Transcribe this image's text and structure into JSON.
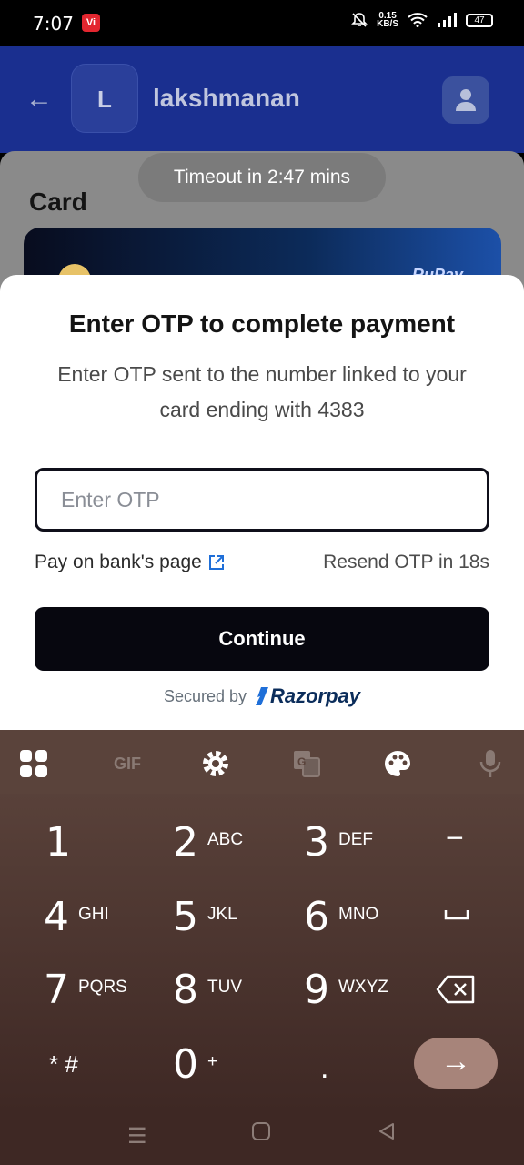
{
  "status_bar": {
    "time": "7:07",
    "carrier_badge": "Vi",
    "net_speed_value": "0.15",
    "net_speed_unit": "KB/S",
    "battery": "47"
  },
  "app": {
    "avatar_letter": "L",
    "merchant_name": "lakshmanan",
    "section_title": "Card",
    "card_brand": "RuPay",
    "timeout_text": "Timeout in 2:47 mins"
  },
  "otp_sheet": {
    "title": "Enter OTP to complete payment",
    "subtitle": "Enter OTP sent to the number linked to your card ending with 4383",
    "input_placeholder": "Enter OTP",
    "input_value": "",
    "bank_page_link": "Pay on bank's page",
    "resend_text": "Resend OTP in 18s",
    "continue_label": "Continue",
    "secured_by": "Secured by",
    "provider": "Razorpay"
  },
  "keyboard": {
    "toolbar": [
      "apps-grid-icon",
      "gif",
      "settings-icon",
      "translate-icon",
      "palette-icon",
      "mic-icon"
    ],
    "gif_label": "GIF",
    "keys": {
      "k1": {
        "num": "1",
        "letters": ""
      },
      "k2": {
        "num": "2",
        "letters": "ABC"
      },
      "k3": {
        "num": "3",
        "letters": "DEF"
      },
      "k4": {
        "num": "4",
        "letters": "GHI"
      },
      "k5": {
        "num": "5",
        "letters": "JKL"
      },
      "k6": {
        "num": "6",
        "letters": "MNO"
      },
      "k7": {
        "num": "7",
        "letters": "PQRS"
      },
      "k8": {
        "num": "8",
        "letters": "TUV"
      },
      "k9": {
        "num": "9",
        "letters": "WXYZ"
      },
      "k0": {
        "num": "0",
        "letters": "+"
      },
      "star": "* #",
      "minus": "−",
      "dot": ".",
      "enter": "→"
    }
  },
  "colors": {
    "primary_button": "#07070f",
    "header": "#1a2f8f",
    "keyboard_bg": "#4e362f",
    "enter_key": "#a7847a"
  }
}
